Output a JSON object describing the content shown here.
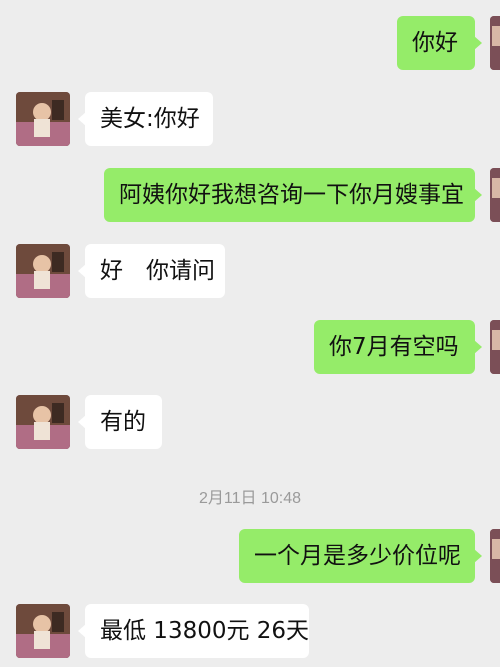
{
  "messages": [
    {
      "side": "out",
      "text": "你好"
    },
    {
      "side": "in",
      "text": "美女:你好"
    },
    {
      "side": "out",
      "text": "阿姨你好我想咨询一下你月嫂事宜"
    },
    {
      "side": "in",
      "text": "好　你请问"
    },
    {
      "side": "out",
      "text": "你7月有空吗"
    },
    {
      "side": "in",
      "text": "有的"
    },
    {
      "side": "out",
      "text": "一个月是多少价位呢"
    },
    {
      "side": "in",
      "text": "最低 13800元 26天"
    }
  ],
  "timestamp": "2月11日 10:48",
  "colors": {
    "background": "#ededed",
    "outgoing_bubble": "#95ec69",
    "incoming_bubble": "#ffffff",
    "timestamp_text": "#9a9a9a"
  },
  "icons": {
    "contact_avatar": "avatar-icon",
    "own_avatar": "avatar-icon"
  }
}
